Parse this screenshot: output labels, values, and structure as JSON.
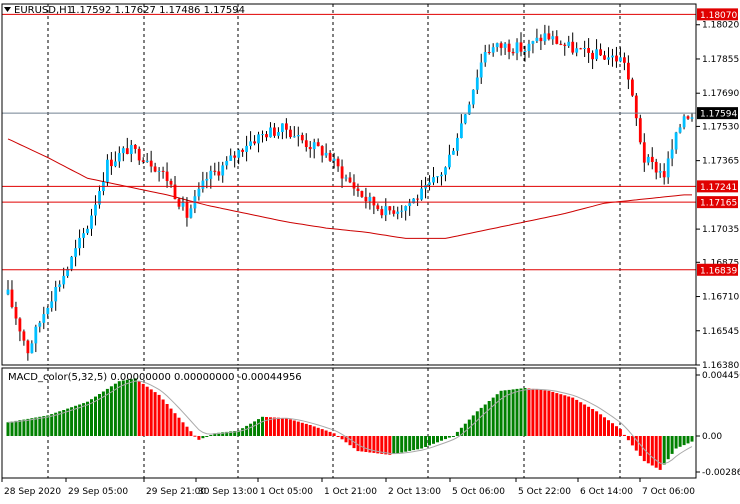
{
  "header": {
    "symbol": "EURUSD,H1",
    "ohlc": "1.17592 1.17627 1.17486 1.17594",
    "dropdown_icon": "triangle-down-icon"
  },
  "indicator": {
    "label": "MACD_color(5,32,5) 0.00000000 0.00000000 -0.00044956",
    "axis_labels": [
      "0.0044506",
      "0.00",
      "-0.002869"
    ],
    "axis_values": [
      0.0044506,
      0.0,
      -0.002869
    ]
  },
  "colors": {
    "background": "#ffffff",
    "grid": "#000000",
    "bull": "#00bfff",
    "bear": "#ff0000",
    "wick": "#000000",
    "level_line": "#e00000",
    "ma_line": "#cc0000",
    "price_line": "#708090",
    "hist_up": "#008000",
    "hist_down": "#ff0000",
    "signal_line": "#a9a9a9",
    "label_bg_red": "#e00000",
    "label_bg_dark": "#000000"
  },
  "chart_data": {
    "type": "candlestick",
    "price_axis_labels": [
      "1.18020",
      "1.17855",
      "1.17690",
      "1.17530",
      "1.17365",
      "1.17035",
      "1.16875",
      "1.16710",
      "1.16545",
      "1.16380"
    ],
    "price_axis_values": [
      1.1802,
      1.17855,
      1.1769,
      1.1753,
      1.17365,
      1.17035,
      1.16875,
      1.1671,
      1.16545,
      1.1638
    ],
    "ylim": [
      1.1638,
      1.1812
    ],
    "time_labels": [
      "28 Sep 2020",
      "29 Sep 05:00",
      "29 Sep 21:00",
      "30 Sep 13:00",
      "1 Oct 05:00",
      "1 Oct 21:00",
      "2 Oct 13:00",
      "5 Oct 06:00",
      "5 Oct 22:00",
      "6 Oct 14:00",
      "7 Oct 06:00"
    ],
    "levels": [
      {
        "value": 1.1807,
        "label": "1.18070"
      },
      {
        "value": 1.17241,
        "label": "1.17241"
      },
      {
        "value": 1.17165,
        "label": "1.17165"
      },
      {
        "value": 1.16839,
        "label": "1.16839"
      }
    ],
    "current_price": {
      "value": 1.17594,
      "label": "1.17594"
    },
    "close_anchors": [
      [
        0,
        1.1672
      ],
      [
        5,
        1.1645
      ],
      [
        10,
        1.1668
      ],
      [
        15,
        1.1685
      ],
      [
        20,
        1.1705
      ],
      [
        25,
        1.1735
      ],
      [
        30,
        1.1742
      ],
      [
        35,
        1.1738
      ],
      [
        40,
        1.1728
      ],
      [
        45,
        1.171
      ],
      [
        50,
        1.1728
      ],
      [
        55,
        1.1735
      ],
      [
        60,
        1.1745
      ],
      [
        65,
        1.175
      ],
      [
        70,
        1.1752
      ],
      [
        75,
        1.1745
      ],
      [
        80,
        1.174
      ],
      [
        85,
        1.1728
      ],
      [
        90,
        1.1718
      ],
      [
        95,
        1.1712
      ],
      [
        100,
        1.1715
      ],
      [
        105,
        1.1722
      ],
      [
        110,
        1.1733
      ],
      [
        115,
        1.176
      ],
      [
        120,
        1.179
      ],
      [
        125,
        1.1792
      ],
      [
        130,
        1.179
      ],
      [
        135,
        1.1797
      ],
      [
        140,
        1.1792
      ],
      [
        145,
        1.1788
      ],
      [
        150,
        1.1787
      ],
      [
        155,
        1.1785
      ],
      [
        160,
        1.1737
      ],
      [
        165,
        1.173
      ],
      [
        170,
        1.1759
      ]
    ],
    "ma_anchors": [
      [
        0,
        1.1747
      ],
      [
        10,
        1.1738
      ],
      [
        20,
        1.1728
      ],
      [
        30,
        1.1724
      ],
      [
        40,
        1.172
      ],
      [
        50,
        1.1715
      ],
      [
        60,
        1.1711
      ],
      [
        70,
        1.1707
      ],
      [
        80,
        1.1704
      ],
      [
        90,
        1.1702
      ],
      [
        100,
        1.1699
      ],
      [
        110,
        1.1699
      ],
      [
        120,
        1.1703
      ],
      [
        130,
        1.1707
      ],
      [
        140,
        1.1711
      ],
      [
        150,
        1.1716
      ],
      [
        160,
        1.1718
      ],
      [
        170,
        1.172
      ]
    ],
    "macd_anchors": [
      [
        0,
        0.001
      ],
      [
        10,
        0.0015
      ],
      [
        20,
        0.0025
      ],
      [
        28,
        0.004
      ],
      [
        32,
        0.0042
      ],
      [
        38,
        0.003
      ],
      [
        44,
        0.001
      ],
      [
        48,
        -0.0003
      ],
      [
        52,
        0.0002
      ],
      [
        58,
        0.0004
      ],
      [
        64,
        0.0014
      ],
      [
        70,
        0.0013
      ],
      [
        76,
        0.0008
      ],
      [
        82,
        0.0002
      ],
      [
        88,
        -0.0012
      ],
      [
        96,
        -0.0015
      ],
      [
        104,
        -0.001
      ],
      [
        112,
        0.0
      ],
      [
        118,
        0.0018
      ],
      [
        124,
        0.0033
      ],
      [
        130,
        0.0035
      ],
      [
        136,
        0.0033
      ],
      [
        142,
        0.0028
      ],
      [
        148,
        0.0018
      ],
      [
        154,
        0.0005
      ],
      [
        160,
        -0.002
      ],
      [
        164,
        -0.0027
      ],
      [
        168,
        -0.001
      ],
      [
        172,
        -0.00045
      ]
    ]
  }
}
